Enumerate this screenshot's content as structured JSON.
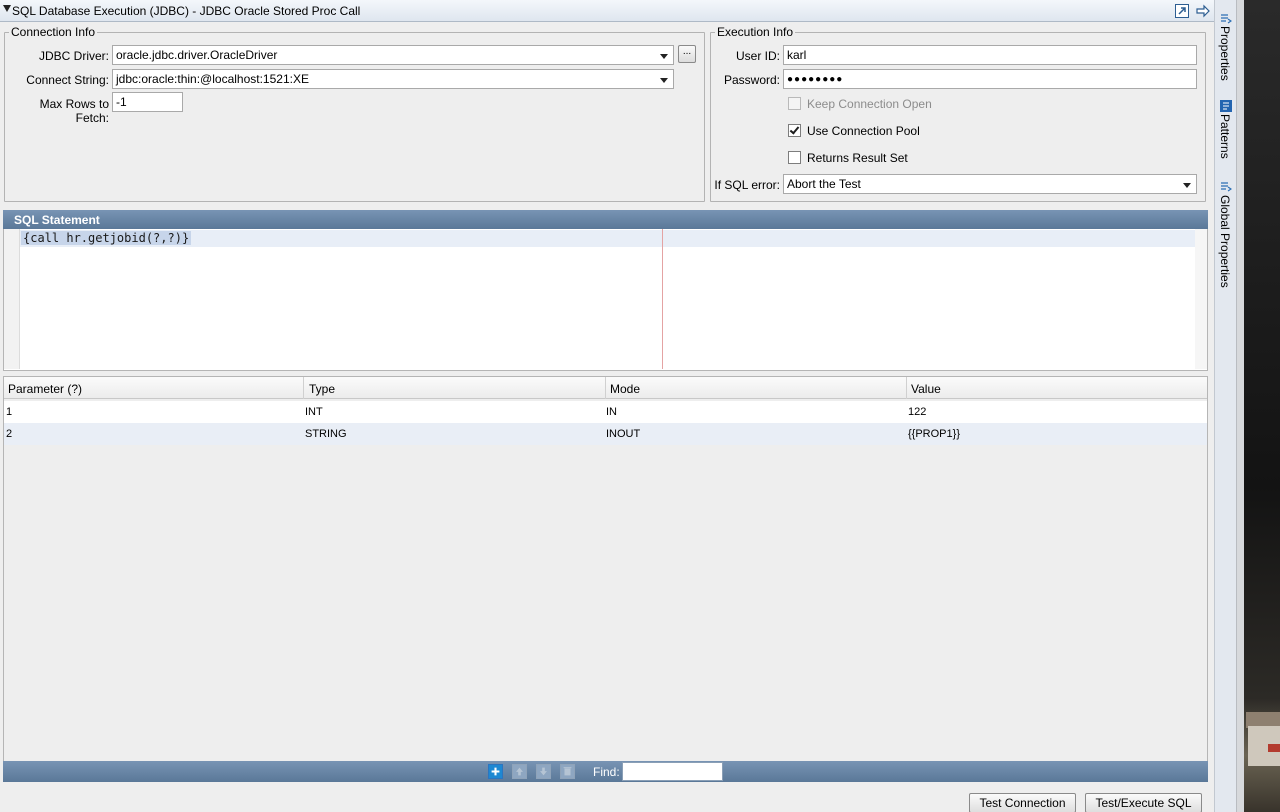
{
  "window": {
    "title": "SQL Database Execution (JDBC) - JDBC Oracle Stored Proc Call"
  },
  "connection_info": {
    "legend": "Connection Info",
    "jdbc_driver_label": "JDBC Driver:",
    "jdbc_driver_value": "oracle.jdbc.driver.OracleDriver",
    "browse_button": "...",
    "connect_string_label": "Connect String:",
    "connect_string_value": "jdbc:oracle:thin:@localhost:1521:XE",
    "max_rows_label": "Max Rows to Fetch:",
    "max_rows_value": "-1"
  },
  "execution_info": {
    "legend": "Execution Info",
    "user_id_label": "User ID:",
    "user_id_value": "karl",
    "password_label": "Password:",
    "password_value": "●●●●●●●●",
    "keep_connection_open": "Keep Connection Open",
    "keep_connection_open_checked": false,
    "use_connection_pool": "Use Connection Pool",
    "use_connection_pool_checked": true,
    "returns_result_set": "Returns Result Set",
    "returns_result_set_checked": false,
    "if_sql_error_label": "If SQL error:",
    "if_sql_error_value": "Abort the Test"
  },
  "sql_statement": {
    "header": "SQL Statement",
    "code": "{call hr.getjobid(?,?)}"
  },
  "parameters": {
    "columns": [
      "Parameter (?)",
      "Type",
      "Mode",
      "Value"
    ],
    "rows": [
      [
        "1",
        "INT",
        "IN",
        "122"
      ],
      [
        "2",
        "STRING",
        "INOUT",
        "{{PROP1}}"
      ]
    ]
  },
  "table_toolbar": {
    "find_label": "Find:",
    "find_value": ""
  },
  "buttons": {
    "test_connection": "Test Connection",
    "test_execute_sql": "Test/Execute SQL"
  },
  "sidebar": {
    "tabs": [
      "Properties",
      "Patterns",
      "Global Properties"
    ]
  },
  "colors": {
    "section_header": "#5a7898",
    "selection": "#c7d5ea",
    "alt_row": "#e9eef6"
  }
}
